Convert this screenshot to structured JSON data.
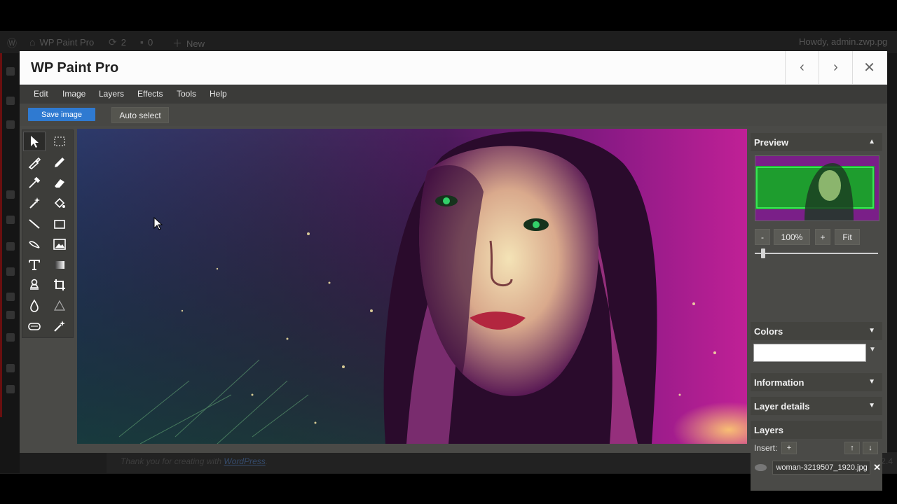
{
  "wp": {
    "site_name": "WP Paint Pro",
    "updates_count": "2",
    "comments_count": "0",
    "new_label": "New",
    "howdy": "Howdy, admin.zwp.pg",
    "footer_thanks": "Thank you for creating with",
    "footer_link": "WordPress",
    "footer_version": "Version 5.2.4"
  },
  "modal": {
    "title": "WP Paint Pro",
    "prev_icon": "chevron-left-icon",
    "next_icon": "chevron-right-icon",
    "close_icon": "close-icon"
  },
  "menu": {
    "items": [
      "Edit",
      "Image",
      "Layers",
      "Effects",
      "Tools",
      "Help"
    ]
  },
  "toolbar": {
    "save_label": "Save image",
    "auto_select_label": "Auto select"
  },
  "tools": [
    {
      "name": "select-tool-icon"
    },
    {
      "name": "marquee-select-icon"
    },
    {
      "name": "brush-icon"
    },
    {
      "name": "pencil-icon"
    },
    {
      "name": "color-picker-icon"
    },
    {
      "name": "eraser-icon"
    },
    {
      "name": "magic-wand-icon"
    },
    {
      "name": "fill-icon"
    },
    {
      "name": "line-icon"
    },
    {
      "name": "rectangle-icon"
    },
    {
      "name": "curve-icon"
    },
    {
      "name": "image-icon"
    },
    {
      "name": "text-icon"
    },
    {
      "name": "gradient-icon"
    },
    {
      "name": "clone-stamp-icon"
    },
    {
      "name": "crop-icon"
    },
    {
      "name": "blur-icon"
    },
    {
      "name": "sharpen-icon"
    },
    {
      "name": "bulge-icon"
    },
    {
      "name": "sparkle-icon"
    }
  ],
  "panels": {
    "preview": {
      "title": "Preview",
      "zoom_minus": "-",
      "zoom_value": "100%",
      "zoom_plus": "+",
      "fit": "Fit",
      "zoom_slider_level": 0.05
    },
    "colors": {
      "title": "Colors",
      "value": "#ffffff"
    },
    "information": {
      "title": "Information"
    },
    "layer_details": {
      "title": "Layer details"
    },
    "layers": {
      "title": "Layers",
      "insert_label": "Insert:",
      "insert_btn": "+",
      "up_btn": "↑",
      "down_btn": "↓",
      "items": [
        {
          "name": "woman-3219507_1920.jpg"
        }
      ]
    }
  },
  "colors": {
    "accent": "#2f7ad1",
    "panel_bg": "#4a4a47",
    "menubar_bg": "#3b3b39"
  }
}
